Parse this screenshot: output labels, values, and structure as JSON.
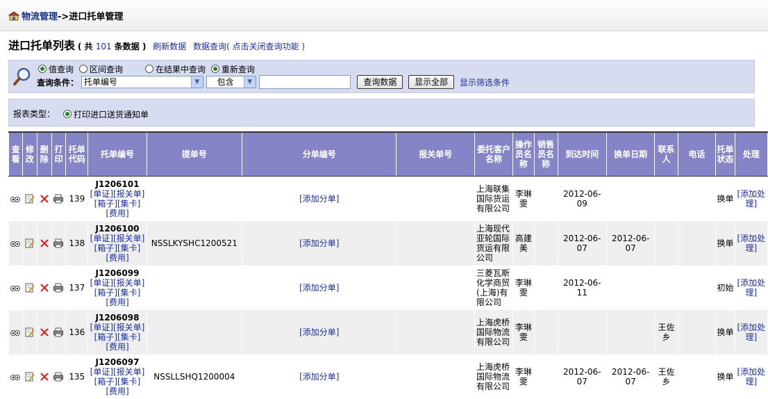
{
  "breadcrumb": {
    "home": "物流管理",
    "separator": "->",
    "current": "进口托单管理"
  },
  "list": {
    "title": "进口托单列表",
    "count_prefix": "( 共",
    "count": "101",
    "count_suffix": "条数据 )",
    "refresh_link": "刷新数据",
    "query_link": "数据查询( 点击关闭查询功能 )"
  },
  "search": {
    "modes": [
      "值查询",
      "区间查询",
      "在结果中查询",
      "重新查询"
    ],
    "label": "查询条件：",
    "field_select": "托单编号",
    "operator_select": "包含",
    "value": "",
    "query_button": "查询数据",
    "show_all_button": "显示全部",
    "filter_link": "显示筛选条件"
  },
  "report": {
    "label": "报表类型：",
    "option": "打印进口送货通知单"
  },
  "table": {
    "headers": {
      "view": "查看",
      "edit": "修改",
      "delete": "删除",
      "print": "打印",
      "code": "托单代码",
      "order_no": "托单编号",
      "bl_no": "提单号",
      "sub_no": "分单编号",
      "customs_no": "报关单号",
      "client": "委托客户名称",
      "operator": "操作员名称",
      "sales": "销售员名称",
      "arrival": "到达时间",
      "exchange_date": "换单日期",
      "contact": "联系人",
      "phone": "电话",
      "status": "托单状态",
      "action": "处理"
    },
    "doc_links": "[单证][报关单][箱子][集卡][费用]",
    "add_sub_link": "[添加分单]",
    "add_action_link": "[添加处理]",
    "rows": [
      {
        "code": "139",
        "order_no": "J1206101",
        "bl_no": "",
        "client": "上海联集国际货运有限公司",
        "operator": "李琳雯",
        "sales": "",
        "arrival": "2012-06-09",
        "exchange_date": "",
        "contact": "",
        "phone": "",
        "status": "换单"
      },
      {
        "code": "138",
        "order_no": "J1206100",
        "bl_no": "NSSLKYSHC1200521",
        "client": "上海现代亚轮国际货运有限公司",
        "operator": "高建美",
        "sales": "",
        "arrival": "2012-06-07",
        "exchange_date": "2012-06-07",
        "contact": "",
        "phone": "",
        "status": "换单"
      },
      {
        "code": "137",
        "order_no": "J1206099",
        "bl_no": "",
        "client": "三菱瓦斯化学商贸(上海)有限公司",
        "operator": "李琳雯",
        "sales": "",
        "arrival": "2012-06-11",
        "exchange_date": "",
        "contact": "",
        "phone": "",
        "status": "初始"
      },
      {
        "code": "136",
        "order_no": "J1206098",
        "bl_no": "",
        "client": "上海虎桥国际物流有限公司",
        "operator": "李琳雯",
        "sales": "",
        "arrival": "",
        "exchange_date": "",
        "contact": "王佐乡",
        "phone": "",
        "status": "换单"
      },
      {
        "code": "135",
        "order_no": "J1206097",
        "bl_no": "NSSLLSHQ1200004",
        "client": "上海虎桥国际物流有限公司",
        "operator": "李琳雯",
        "sales": "",
        "arrival": "2012-06-07",
        "exchange_date": "2012-06-07",
        "contact": "王佐乡",
        "phone": "",
        "status": "换单"
      }
    ]
  }
}
